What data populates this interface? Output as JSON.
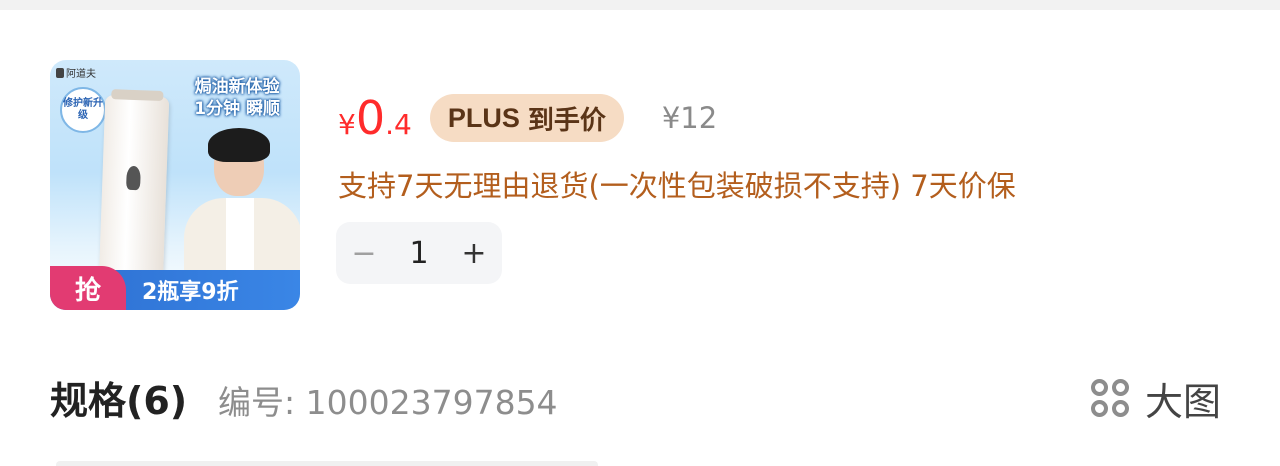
{
  "product": {
    "image": {
      "brand": "阿道夫",
      "headline_line1": "焗油新体验",
      "headline_line2": "1分钟 瞬顺",
      "badge": "修护新升级",
      "promo_grab": "抢",
      "promo_text": "2瓶享9折"
    },
    "price": {
      "currency": "¥",
      "integer": "0",
      "decimal": ".4"
    },
    "plus_badge": {
      "word": "PLUS",
      "label": "到手价"
    },
    "original_price": "¥12",
    "service_text": "支持7天无理由退货(一次性包装破损不支持)  7天价保",
    "quantity": "1",
    "stepper": {
      "minus": "−",
      "plus": "+"
    }
  },
  "spec": {
    "title": "规格(6)",
    "sku_label": "编号: 100023797854",
    "big_image_label": "大图"
  },
  "colors": {
    "price_red": "#ff2b2b",
    "plus_bg": "#f6dcc4",
    "service_orange": "#b35e1d"
  },
  "icons": {
    "big_image": "grid-four-circles-icon",
    "minus": "minus-icon",
    "plus": "plus-icon"
  }
}
